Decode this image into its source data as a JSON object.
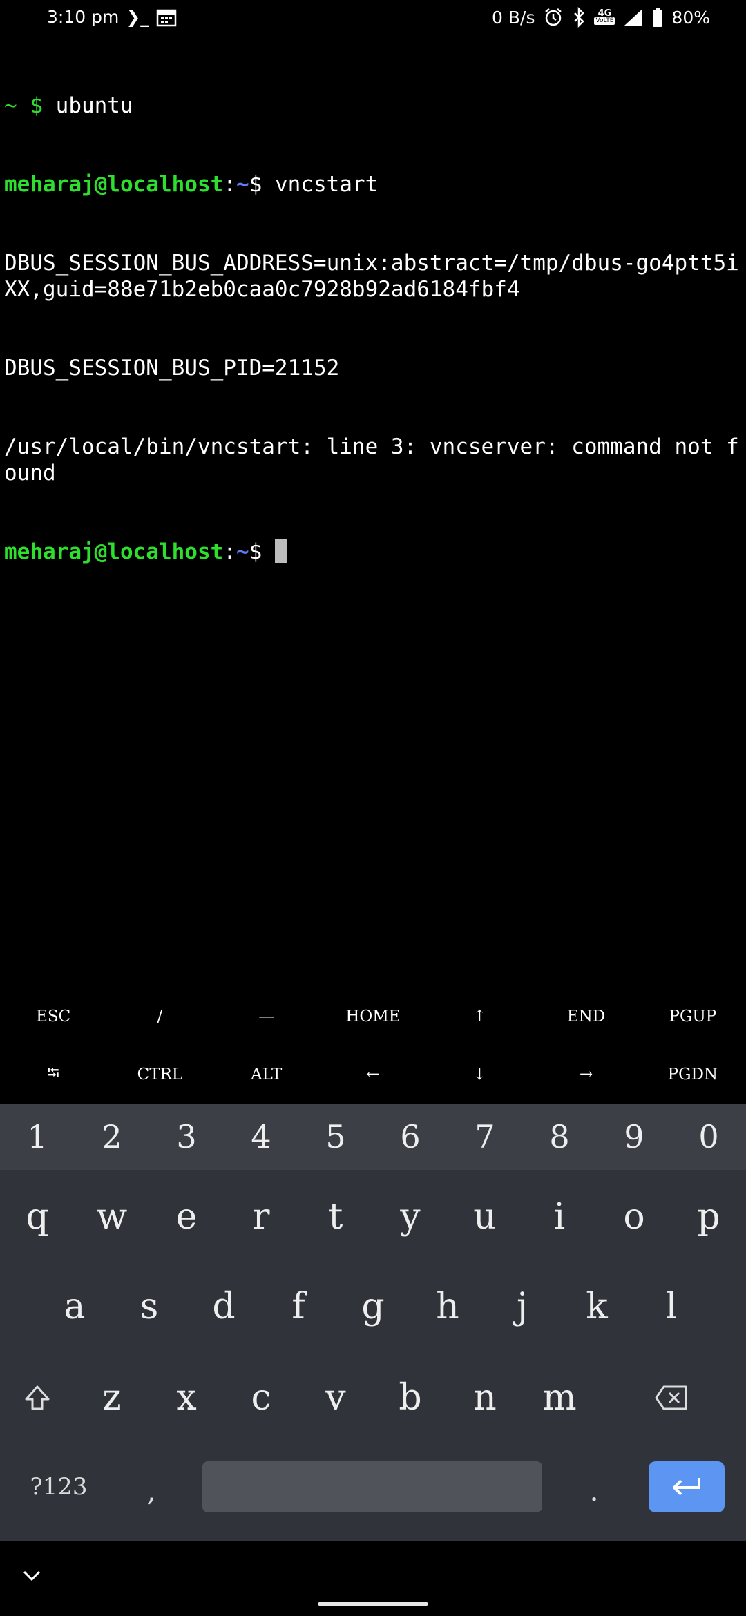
{
  "status_bar": {
    "time": "3:10 pm",
    "terminal_glyph": "❯_",
    "data_speed": "0 B/s",
    "network": "4G",
    "volte": "VoLTE",
    "battery": "80%"
  },
  "terminal": {
    "line1_prefix": "~ $ ",
    "line1_cmd": "ubuntu",
    "prompt_user": "meharaj@localhost",
    "prompt_colon": ":",
    "prompt_path": "~",
    "prompt_dollar": "$ ",
    "cmd2": "vncstart",
    "out1": "DBUS_SESSION_BUS_ADDRESS=unix:abstract=/tmp/dbus-go4ptt5iXX,guid=88e71b2eb0caa0c7928b92ad6184fbf4",
    "out2": "DBUS_SESSION_BUS_PID=21152",
    "out3": "/usr/local/bin/vncstart: line 3: vncserver: command not found"
  },
  "extra_keys": {
    "row1": [
      "ESC",
      "/",
      "—",
      "HOME",
      "↑",
      "END",
      "PGUP"
    ],
    "row2": [
      "⭾",
      "CTRL",
      "ALT",
      "←",
      "↓",
      "→",
      "PGDN"
    ]
  },
  "keyboard": {
    "numbers": [
      "1",
      "2",
      "3",
      "4",
      "5",
      "6",
      "7",
      "8",
      "9",
      "0"
    ],
    "row_q": [
      "q",
      "w",
      "e",
      "r",
      "t",
      "y",
      "u",
      "i",
      "o",
      "p"
    ],
    "row_a": [
      "a",
      "s",
      "d",
      "f",
      "g",
      "h",
      "j",
      "k",
      "l"
    ],
    "row_z": [
      "z",
      "x",
      "c",
      "v",
      "b",
      "n",
      "m"
    ],
    "symbols_label": "?123",
    "comma": ",",
    "period": "."
  }
}
